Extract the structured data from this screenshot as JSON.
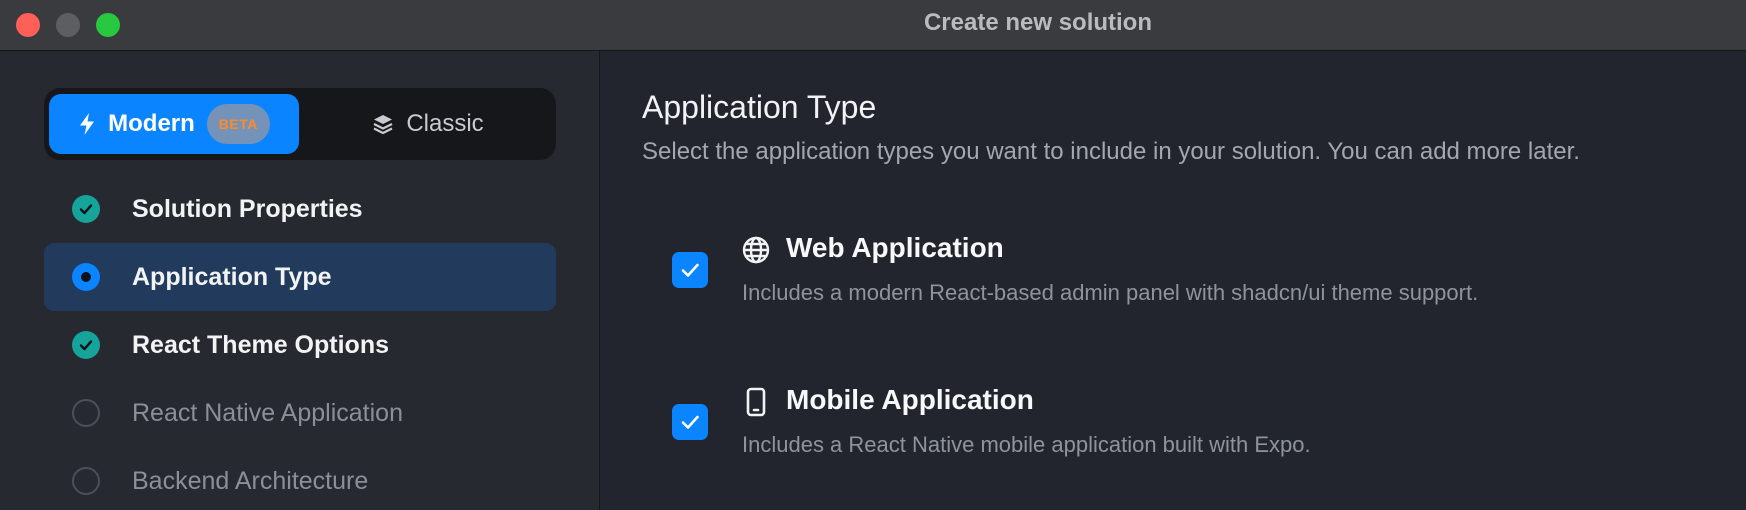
{
  "window": {
    "title": "Create new solution"
  },
  "sidebar": {
    "mode_toggle": {
      "modern_label": "Modern",
      "modern_badge": "BETA",
      "classic_label": "Classic",
      "selected": "Modern"
    },
    "steps": [
      {
        "label": "Solution Properties",
        "status": "done"
      },
      {
        "label": "Application Type",
        "status": "current"
      },
      {
        "label": "React Theme Options",
        "status": "done"
      },
      {
        "label": "React Native Application",
        "status": "todo"
      },
      {
        "label": "Backend Architecture",
        "status": "todo"
      }
    ]
  },
  "main": {
    "title": "Application Type",
    "description": "Select the application types you want to include in your solution. You can add more later.",
    "options": [
      {
        "title": "Web Application",
        "description": "Includes a modern React-based admin panel with shadcn/ui theme support.",
        "icon": "globe-icon",
        "checked": true
      },
      {
        "title": "Mobile Application",
        "description": "Includes a React Native mobile application built with Expo.",
        "icon": "mobile-icon",
        "checked": true
      }
    ]
  },
  "colors": {
    "accent": "#0a84ff",
    "done": "#15a39a",
    "badge_text": "#ff8a2a"
  }
}
